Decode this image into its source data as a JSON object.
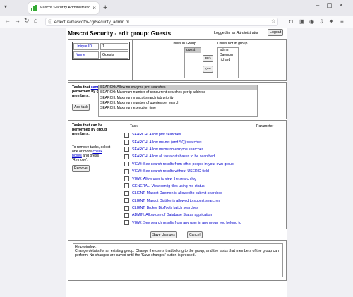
{
  "browser": {
    "tab_title": "Mascot Security Administratio",
    "url": "eclectus/mascot/x-cgi/security_admin.pl"
  },
  "header": {
    "title": "Mascot Security - edit group: Guests",
    "logged_in_prefix": "Logged in as",
    "logged_in_user": "Administrator",
    "logout_label": "Logout"
  },
  "group": {
    "id_label": "Unique ID",
    "id_value": "1",
    "name_label": "Name",
    "name_value": "Guests"
  },
  "membership": {
    "users_in_group_label": "Users in Group",
    "users_not_in_group_label": "Users not in group",
    "users_in_group": [
      "guest"
    ],
    "users_not_in_group": [
      "admin",
      "Daemon",
      "richard"
    ],
    "add_button": "==>",
    "remove_button": "<=="
  },
  "cannot_section": {
    "title_prefix": "Tasks that",
    "title_link": "cannot",
    "title_suffix": "be performed by group members:",
    "add_button": "Add task",
    "tasks": [
      "SEARCH: Allow no enzyme pmf searches",
      "SEARCH: Maximum number of concurrent searches per ip address",
      "SEARCH: Maximum mascot search job priority",
      "SEARCH: Maximum number of queries per search",
      "SEARCH: Maximum execution time"
    ]
  },
  "can_section": {
    "title": "Tasks that can be performed by group members:",
    "remove_help_1": "To remove tasks, select one or more",
    "remove_help_link": "check boxes",
    "remove_help_2": "and press 'Remove'.",
    "remove_button": "Remove",
    "task_header": "Task",
    "parameter_header": "Parameter",
    "tasks": [
      "SEARCH: Allow pmf searches",
      "SEARCH: Allow ms-ms (and SQ) searches",
      "SEARCH: Allow msms no enzyme searches",
      "SEARCH: Allow all fasta databases to be searched",
      "VIEW: See search results from other people in your own group",
      "VIEW: See search results without USERID field",
      "VIEW: Allow user to view the search log",
      "GENERAL: View config files using ms-status",
      "CLIENT: Mascot Daemon is allowed to submit searches",
      "CLIENT: Mascot Distiller is allowed to submit searches",
      "CLIENT: Bruker BioTools batch searches",
      "ADMIN: Allow use of Database Status application",
      "VIEW: See search results from any user in any group you belong to"
    ]
  },
  "actions": {
    "save_label": "Save changes",
    "cancel_label": "Cancel"
  },
  "help": {
    "text": "Help window.\nChange details for an existing group. Change the users that belong to the group, and the tasks that members of the group can perform. No changes are saved until the 'Save changes' button is pressed."
  }
}
